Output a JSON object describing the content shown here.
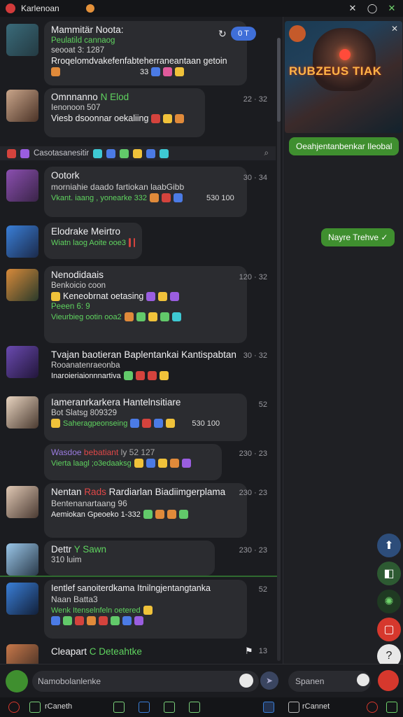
{
  "window": {
    "title": "Karlenoan",
    "controls": [
      "✕",
      "◯",
      "✕"
    ]
  },
  "messages": [
    {
      "name": "Mammitär Noota:",
      "sub": "Peulatild cannaog",
      "sub2": "seooat 3: 1287",
      "body": "Rroqelomdvakefenfabteherraneantaan getoin",
      "time": "",
      "count": "0 T"
    },
    {
      "name": "Omnnanno",
      "tag": "N Elod",
      "sub": "Ienonoon 507",
      "body": "Viesb dsoonnar oekaliing",
      "time": "22 · 32"
    },
    {
      "name": "Ootork",
      "sub": "morniahie daado fartiokan laabGibb",
      "body": "Vkant. iaang , yonearke 332",
      "body2": "530 100",
      "time": "30 · 34"
    },
    {
      "name": "Elodrake Meirtro",
      "body": "Wiatn laog Aoite ooe3",
      "time": ""
    },
    {
      "name": "Nenodidaais",
      "sub": "Benkoicio coon",
      "body": "Keneobrnat oetasing",
      "sub2": "Peeen  6: 9",
      "body2": "Vieurbieg ootin ooa2",
      "time": "120 · 32"
    },
    {
      "name": "Tvajan baotieran Baplentankai Kantispabtan",
      "sub": "Rooanatenraeonba",
      "body": "Inaroieriaionnnartiva",
      "time": "30 · 32"
    },
    {
      "name": "Iameranrkarkera Hantelnsitiare",
      "sub": "Bot Slatsg 809329",
      "body": "Saheragpeonseing",
      "body2": "530 100",
      "time": "52"
    },
    {
      "name": "Wasdoe",
      "tag": "bebatiant",
      "extra": "ly 52 127",
      "body": "Vierta laagl ;o3edaaksg",
      "time": "230 · 23"
    },
    {
      "name": "Nentan",
      "tag": "Rads",
      "rest": "Rardiarlan Biadiimgerplama",
      "sub": "Bentenanartaang 96",
      "body": "Aemiokan Gpeoeko 1-332",
      "time": "230 · 23"
    },
    {
      "name": "Dettr",
      "tag": "Y Sawn",
      "sub": "310 luim",
      "time": "230 · 23"
    },
    {
      "name": "Ientlef sanoiterdkama Itnilngjentangtanka",
      "sub": "Naan Batta3",
      "body": "Wenk Itenselnfeln oetered",
      "time": "52"
    },
    {
      "name": "Cleapart",
      "tag": "C Deteahtke",
      "time": "13"
    }
  ],
  "system_row": {
    "label": "Casotasanesitir"
  },
  "right_panel": {
    "hero_title": "RUBZEUS TIAK",
    "bubble1": "Oeahjentanbenkar Ileobal",
    "bubble2": "Nayre Trehve ✓"
  },
  "composer": {
    "placeholder": "Namobolanlenke",
    "placeholder2": "Spanen"
  },
  "taskbar": {
    "left_label": "rCaneth",
    "right_label": "rCannet"
  }
}
